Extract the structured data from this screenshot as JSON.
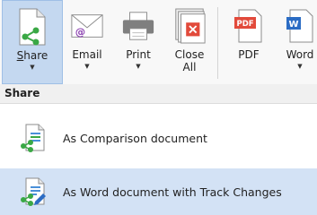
{
  "ribbon": {
    "buttons": [
      {
        "label_u": "S",
        "label_rest": "hare",
        "icon": "share-icon"
      },
      {
        "label": "Email",
        "icon": "email-icon"
      },
      {
        "label": "Print",
        "icon": "printer-icon"
      },
      {
        "label": "Close\nAll",
        "icon": "close-all-icon"
      },
      {
        "label": "PDF",
        "icon": "pdf-icon",
        "badge": "PDF"
      },
      {
        "label": "Word",
        "icon": "word-icon",
        "badge": "W"
      }
    ]
  },
  "dropdown": {
    "header": "Share",
    "items": [
      {
        "label": "As Comparison document",
        "icon": "comparison-share-icon"
      },
      {
        "label": "As Word document with Track Changes",
        "icon": "word-track-changes-share-icon"
      }
    ]
  },
  "colors": {
    "active_bg": "#c4d8f0",
    "hover_bg": "#d3e2f5",
    "share_green": "#3aa845",
    "pdf_red": "#e24a3b",
    "word_blue": "#2b6cc4"
  }
}
